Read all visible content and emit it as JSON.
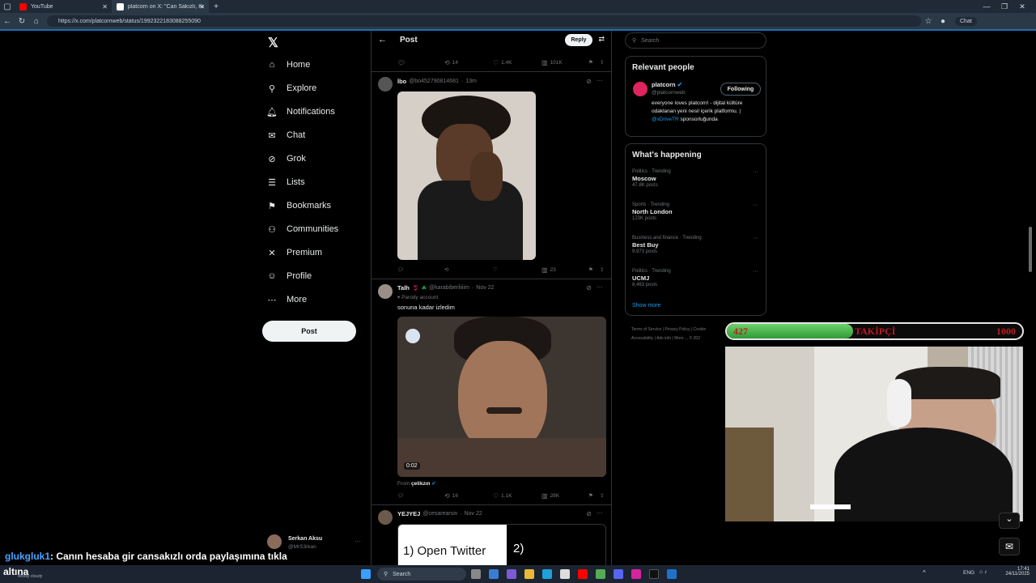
{
  "browser": {
    "tabs": [
      {
        "title": "YouTube",
        "color": "#ff0000"
      },
      {
        "title": "platcorn on X: \"Can Sakızlı, Kick o",
        "color": "#ffffff"
      }
    ],
    "url": "https://x.com/platcornweb/status/1992322183088255090"
  },
  "nav": {
    "items": [
      {
        "label": "Home",
        "icon": "home-icon"
      },
      {
        "label": "Explore",
        "icon": "search-icon"
      },
      {
        "label": "Notifications",
        "icon": "bell-icon"
      },
      {
        "label": "Chat",
        "icon": "mail-icon"
      },
      {
        "label": "Grok",
        "icon": "grok-icon"
      },
      {
        "label": "Lists",
        "icon": "list-icon"
      },
      {
        "label": "Bookmarks",
        "icon": "bookmark-icon"
      },
      {
        "label": "Communities",
        "icon": "people-icon"
      },
      {
        "label": "Premium",
        "icon": "x-icon"
      },
      {
        "label": "Profile",
        "icon": "person-icon"
      },
      {
        "label": "More",
        "icon": "more-circle-icon"
      }
    ],
    "post_label": "Post",
    "account": {
      "name": "Serkan Aksu",
      "handle": "@MrS3rkan"
    }
  },
  "timeline": {
    "header_title": "Post",
    "reply_label": "Reply",
    "top_actions": {
      "retweets": "14",
      "likes": "1.4K",
      "views": "101K"
    },
    "tweet1": {
      "name": "İbo",
      "handle": "@bo452790814681",
      "time": "13m",
      "actions": {
        "views": "23"
      }
    },
    "tweet2": {
      "name": "Talh",
      "handle": "@karabiberliiiim",
      "time": "Nov 22",
      "parody": "Parody account",
      "text": "sonuna kadar izledim",
      "video_time": "0:02",
      "from_label": "From",
      "from_name": "çelikzın",
      "actions": {
        "retweets": "16",
        "likes": "1.1K",
        "views": "28K"
      }
    },
    "tweet3": {
      "name": "YEJYEJ",
      "handle": "@cesarearsiv",
      "time": "Nov 22",
      "card_text": "1) Open Twitter",
      "card_text2": "2)"
    }
  },
  "right": {
    "search_placeholder": "Search",
    "relevant": {
      "title": "Relevant people",
      "name": "platcorn",
      "handle": "@platcornweb",
      "follow_label": "Following",
      "bio": "everyone loves platcorn! - dijital kültüre odaklanan yeni nesil içerik platformu. |",
      "bio_link": "@xDriveTR",
      "bio_end": "sponsorluğunda"
    },
    "happening": {
      "title": "What's happening",
      "trends": [
        {
          "meta": "Politics · Trending",
          "name": "Moscow",
          "count": "47.8K posts"
        },
        {
          "meta": "Sports · Trending",
          "name": "North London",
          "count": "123K posts"
        },
        {
          "meta": "Business and finance · Trending",
          "name": "Best Buy",
          "count": "9,973 posts"
        },
        {
          "meta": "Politics · Trending",
          "name": "UCMJ",
          "count": "8,463 posts"
        }
      ],
      "show_more": "Show more"
    },
    "footer": [
      "Terms of Service",
      "|",
      "Privacy Policy",
      "|",
      "Cookie",
      "Accessibility",
      "|",
      "Ads info",
      "|",
      "More ...",
      "© 202"
    ]
  },
  "overlay": {
    "follow_current": "427",
    "follow_label": "TAKİPÇİ",
    "follow_goal": "1000",
    "follow_fraction": 0.427,
    "chat_user": "glukgluk1",
    "chat_msg": ": Canın hesaba gir cansakızlı orda paylaşımına tıkla"
  },
  "taskbar": {
    "weather": "altına",
    "weather_sub": "Mostly cloudy",
    "search": "Search",
    "lang": "ENG",
    "time": "17:41",
    "date": "24/11/2025"
  }
}
